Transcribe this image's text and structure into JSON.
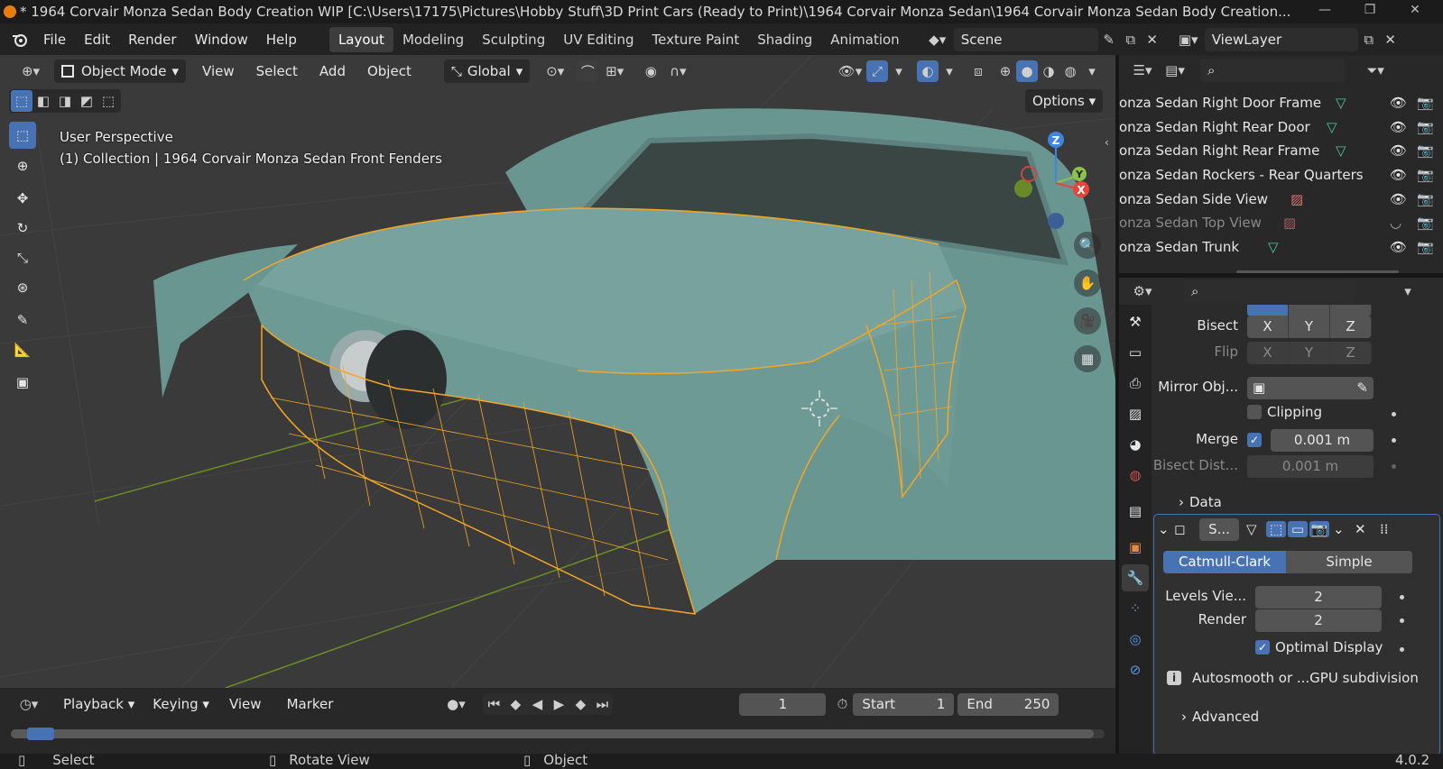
{
  "window": {
    "title": "* 1964 Corvair Monza Sedan Body Creation WIP [C:\\Users\\17175\\Pictures\\Hobby Stuff\\3D Print Cars (Ready to Print)\\1964 Corvair Monza Sedan\\1964 Corvair Monza Sedan Body Creation..."
  },
  "menu": {
    "items": [
      "File",
      "Edit",
      "Render",
      "Window",
      "Help"
    ],
    "workspaces": [
      "Layout",
      "Modeling",
      "Sculpting",
      "UV Editing",
      "Texture Paint",
      "Shading",
      "Animation"
    ],
    "active_workspace": "Layout",
    "scene": "Scene",
    "view_layer": "ViewLayer"
  },
  "viewport": {
    "mode": "Object Mode",
    "menus": [
      "View",
      "Select",
      "Add",
      "Object"
    ],
    "transform_orientation": "Global",
    "options_label": "Options",
    "info_line1": "User Perspective",
    "info_line2": "(1) Collection | 1964 Corvair Monza Sedan Front Fenders",
    "gizmo_axes": [
      "Z",
      "Y",
      "X"
    ]
  },
  "outliner": {
    "rows": [
      {
        "name": "onza Sedan Right Door Frame",
        "type": "mesh",
        "visible": true
      },
      {
        "name": "onza Sedan Right Rear Door",
        "type": "mesh",
        "visible": true
      },
      {
        "name": "onza Sedan Right Rear Frame",
        "type": "mesh",
        "visible": true
      },
      {
        "name": "onza Sedan Rockers - Rear Quarters",
        "type": "mesh",
        "visible": true
      },
      {
        "name": "onza Sedan Side View",
        "type": "image",
        "visible": true
      },
      {
        "name": "onza Sedan Top View",
        "type": "image",
        "visible": false
      },
      {
        "name": "onza Sedan Trunk",
        "type": "mesh",
        "visible": true
      }
    ]
  },
  "properties": {
    "mirror": {
      "bisect_label": "Bisect",
      "flip_label": "Flip",
      "axes": [
        "X",
        "Y",
        "Z"
      ],
      "mirror_object_label": "Mirror Obj...",
      "clipping_label": "Clipping",
      "merge_label": "Merge",
      "merge_value": "0.001 m",
      "bisect_dist_label": "Bisect Dist...",
      "bisect_dist_value": "0.001 m",
      "data_label": "Data"
    },
    "subsurf": {
      "name_short": "S...",
      "mode_catmull": "Catmull-Clark",
      "mode_simple": "Simple",
      "levels_viewport_label": "Levels Vie...",
      "levels_viewport_value": "2",
      "render_label": "Render",
      "render_value": "2",
      "optimal_display_label": "Optimal Display",
      "info_text": "Autosmooth or ...GPU subdivision",
      "advanced_label": "Advanced"
    }
  },
  "timeline": {
    "menus": [
      "Playback",
      "Keying",
      "View",
      "Marker"
    ],
    "current_frame": "1",
    "start_label": "Start",
    "start_value": "1",
    "end_label": "End",
    "end_value": "250"
  },
  "statusbar": {
    "select": "Select",
    "rotate_view": "Rotate View",
    "object": "Object",
    "version": "4.0.2"
  },
  "colors": {
    "accent": "#4772b3",
    "selection": "#f5a623",
    "car_body": "#6e9a96",
    "axis_x": "#e8443a",
    "axis_y": "#8bc34a",
    "axis_z": "#3d86e0"
  }
}
